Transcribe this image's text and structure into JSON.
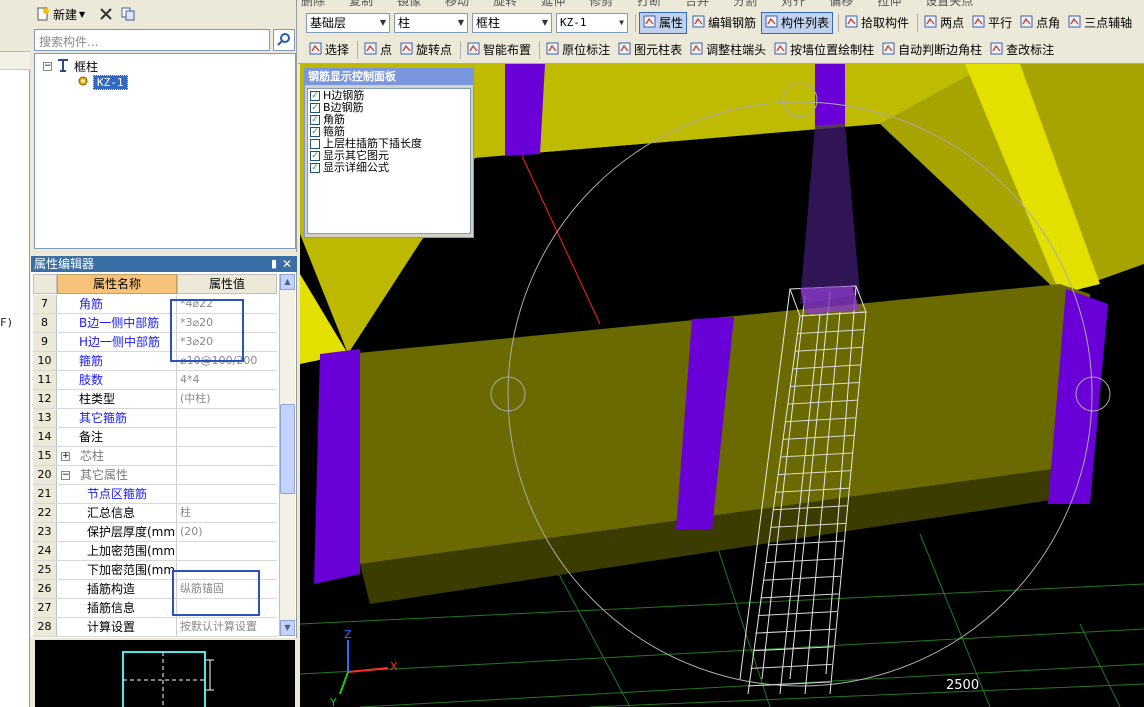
{
  "left_strip": {
    "cut_text": "F)"
  },
  "tree_panel": {
    "new_label": "新建",
    "search_placeholder": "搜索构件...",
    "root_label": "框柱",
    "child_label": "KZ-1"
  },
  "property_editor": {
    "title": "属性编辑器",
    "header_name": "属性名称",
    "header_value": "属性值",
    "rows": [
      {
        "num": "7",
        "name": "角筋",
        "value": "*4⌀22"
      },
      {
        "num": "8",
        "name": "B边一侧中部筋",
        "value": "*3⌀20"
      },
      {
        "num": "9",
        "name": "H边一侧中部筋",
        "value": "*3⌀20"
      },
      {
        "num": "10",
        "name": "箍筋",
        "value": "⌀10@100/200"
      },
      {
        "num": "11",
        "name": "肢数",
        "value": "4*4"
      },
      {
        "num": "12",
        "name": "柱类型",
        "value": "(中柱)"
      },
      {
        "num": "13",
        "name": "其它箍筋",
        "value": ""
      },
      {
        "num": "14",
        "name": "备注",
        "value": ""
      },
      {
        "num": "15",
        "name": "芯柱",
        "value": ""
      },
      {
        "num": "20",
        "name": "其它属性",
        "value": ""
      },
      {
        "num": "21",
        "name": "节点区箍筋",
        "value": ""
      },
      {
        "num": "22",
        "name": "汇总信息",
        "value": "柱"
      },
      {
        "num": "23",
        "name": "保护层厚度(mm)",
        "value": "(20)"
      },
      {
        "num": "24",
        "name": "上加密范围(mm)",
        "value": ""
      },
      {
        "num": "25",
        "name": "下加密范围(mm)",
        "value": ""
      },
      {
        "num": "26",
        "name": "插筋构造",
        "value": "纵筋锚固"
      },
      {
        "num": "27",
        "name": "插筋信息",
        "value": ""
      },
      {
        "num": "28",
        "name": "计算设置",
        "value": "按默认计算设置"
      }
    ]
  },
  "toolbar": {
    "row0_items": [
      "删除",
      "复制",
      "镜像",
      "移动",
      "旋转",
      "延伸",
      "修剪",
      "打断",
      "合并",
      "分割",
      "对齐",
      "偏移",
      "拉伸",
      "设置夹点"
    ],
    "floor_combo": "基础层",
    "type_combo": "柱",
    "subtype_combo": "框柱",
    "element_combo": "KZ-1",
    "row1_items": [
      {
        "label": "属性",
        "icon": "properties-icon"
      },
      {
        "label": "编辑钢筋",
        "icon": "edit-rebar-icon"
      },
      {
        "label": "构件列表",
        "icon": "component-list-icon"
      },
      {
        "label": "拾取构件",
        "icon": "pick-icon"
      },
      {
        "label": "两点",
        "icon": "two-point-icon"
      },
      {
        "label": "平行",
        "icon": "parallel-icon"
      },
      {
        "label": "点角",
        "icon": "point-angle-icon"
      },
      {
        "label": "三点辅轴",
        "icon": "three-point-axis-icon"
      }
    ],
    "row2_items": [
      {
        "label": "选择",
        "icon": "select-icon"
      },
      {
        "label": "点",
        "icon": "point-icon"
      },
      {
        "label": "旋转点",
        "icon": "rotate-point-icon"
      },
      {
        "label": "智能布置",
        "icon": "smart-layout-icon"
      },
      {
        "label": "原位标注",
        "icon": "in-place-annotation-icon"
      },
      {
        "label": "图元柱表",
        "icon": "column-table-icon"
      },
      {
        "label": "调整柱端头",
        "icon": "adjust-column-end-icon"
      },
      {
        "label": "按墙位置绘制柱",
        "icon": "draw-by-wall-icon"
      },
      {
        "label": "自动判断边角柱",
        "icon": "auto-corner-column-icon"
      },
      {
        "label": "查改标注",
        "icon": "edit-annotation-icon"
      }
    ]
  },
  "rebar_panel": {
    "title": "钢筋显示控制面板",
    "options": [
      {
        "label": "H边钢筋",
        "checked": true
      },
      {
        "label": "B边钢筋",
        "checked": true
      },
      {
        "label": "角筋",
        "checked": true
      },
      {
        "label": "箍筋",
        "checked": true
      },
      {
        "label": "上层柱插筋下插长度",
        "checked": false
      },
      {
        "label": "显示其它图元",
        "checked": true
      },
      {
        "label": "显示详细公式",
        "checked": true
      }
    ]
  },
  "viewport": {
    "scale_label": "2500",
    "axis_labels": {
      "x": "X",
      "y": "Y",
      "z": "Z"
    },
    "colors": {
      "beam": "#c9c400",
      "column": "#6a00d8",
      "background": "#000000",
      "grid": "#1f7a1f",
      "cut_line": "#ff2020"
    }
  }
}
